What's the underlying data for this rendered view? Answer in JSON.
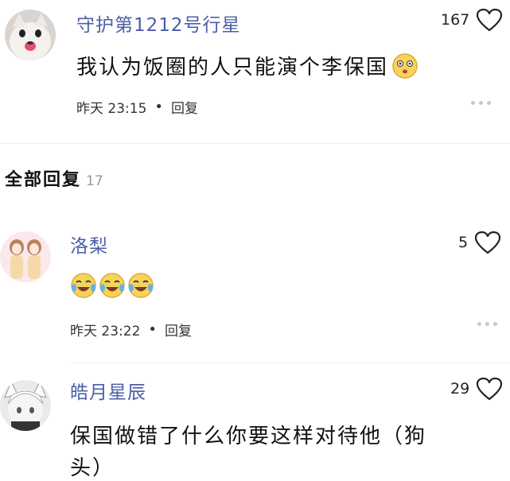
{
  "top_comment": {
    "username": "守护第1212号行星",
    "likes": "167",
    "text": "我认为饭圈的人只能演个李保国",
    "date": "昨天 23:15",
    "reply_label": "回复"
  },
  "section": {
    "title": "全部回复",
    "count": "17"
  },
  "replies": [
    {
      "username": "洛梨",
      "likes": "5",
      "date": "昨天 23:22",
      "reply_label": "回复"
    },
    {
      "username": "皓月星辰",
      "likes": "29",
      "text": "保国做错了什么你要这样对待他（狗",
      "text_cont": "头）"
    }
  ]
}
